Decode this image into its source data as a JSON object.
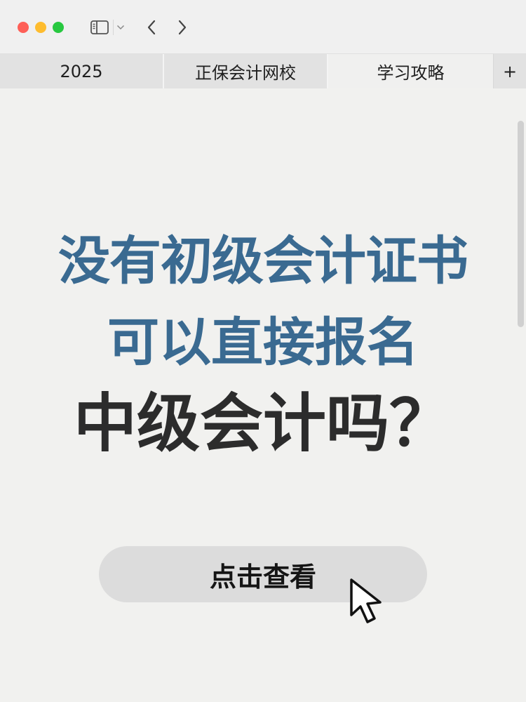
{
  "window": {
    "traffic_lights": {
      "close": "#fe5f57",
      "minimize": "#febc2e",
      "zoom": "#28c840"
    },
    "toolbar_icons": [
      "sidebar-icon",
      "chevron-down-icon",
      "back-arrow-icon",
      "forward-arrow-icon"
    ]
  },
  "tabs": [
    {
      "label": "2025",
      "active": false
    },
    {
      "label": "正保会计网校",
      "active": false
    },
    {
      "label": "学习攻略",
      "active": true
    }
  ],
  "new_tab_label": "+",
  "main": {
    "headline_line1": "没有初级会计证书",
    "headline_line2": "可以直接报名",
    "headline_line3": "中级会计吗？",
    "cta_label": "点击查看",
    "accent_color": "#3a6a91",
    "dark_text_color": "#2c2c2c"
  }
}
